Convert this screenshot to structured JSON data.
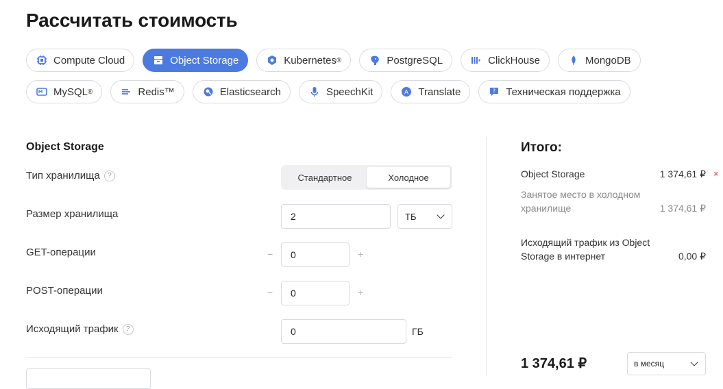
{
  "page_title": "Рассчитать стоимость",
  "services": {
    "row1": [
      {
        "label": "Compute Cloud",
        "icon": "chip-icon",
        "active": false
      },
      {
        "label": "Object Storage",
        "icon": "storage-icon",
        "active": true
      },
      {
        "label": "Kubernetes",
        "sup": "®",
        "icon": "kubernetes-icon",
        "active": false
      },
      {
        "label": "PostgreSQL",
        "icon": "postgresql-icon",
        "active": false
      },
      {
        "label": "ClickHouse",
        "icon": "clickhouse-icon",
        "active": false
      },
      {
        "label": "MongoDB",
        "icon": "mongodb-icon",
        "active": false
      }
    ],
    "row2": [
      {
        "label": "MySQL",
        "sup": "®",
        "icon": "mysql-icon",
        "active": false
      },
      {
        "label": "Redis™",
        "icon": "redis-icon",
        "active": false
      },
      {
        "label": "Elasticsearch",
        "icon": "elasticsearch-icon",
        "active": false
      },
      {
        "label": "SpeechKit",
        "icon": "microphone-icon",
        "active": false
      },
      {
        "label": "Translate",
        "icon": "translate-icon",
        "active": false
      },
      {
        "label": "Техническая поддержка",
        "icon": "support-icon",
        "active": false
      }
    ]
  },
  "accent_color": "#4b7ae0",
  "form": {
    "section_title": "Object Storage",
    "storage_type": {
      "label": "Тип хранилища",
      "options": [
        "Стандартное",
        "Холодное"
      ],
      "selected": "Холодное"
    },
    "storage_size": {
      "label": "Размер хранилища",
      "value": "2",
      "unit": "ТБ"
    },
    "get_ops": {
      "label": "GET-операции",
      "value": "0",
      "minus": "−",
      "plus": "+"
    },
    "post_ops": {
      "label": "POST-операции",
      "value": "0",
      "minus": "−",
      "plus": "+"
    },
    "traffic": {
      "label": "Исходящий трафик",
      "value": "0",
      "unit": "ГБ"
    },
    "help_mark": "?"
  },
  "summary": {
    "title": "Итого:",
    "service_name": "Object Storage",
    "service_total": "1 374,61 ₽",
    "remove_mark": "×",
    "items": [
      {
        "name": "Занятое место в холодном хранилище",
        "value": "1 374,61 ₽"
      },
      {
        "name": "Исходящий трафик из Object Storage в интернет",
        "value": "0,00 ₽"
      }
    ],
    "grand_total": "1 374,61 ₽",
    "period": "в месяц"
  }
}
